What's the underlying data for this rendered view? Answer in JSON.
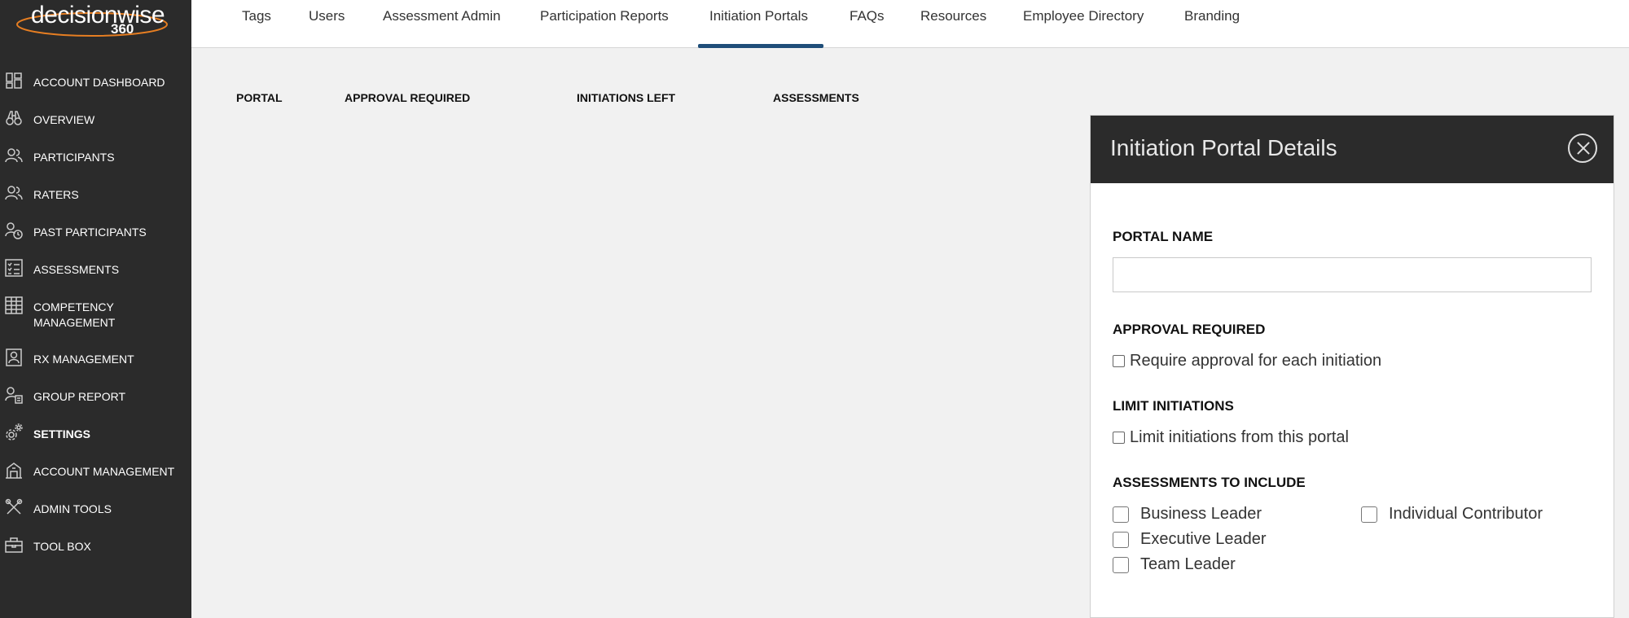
{
  "logo": {
    "name": "decisionwise",
    "suffix": "360"
  },
  "sidebar": {
    "items": [
      {
        "label": "ACCOUNT DASHBOARD",
        "icon": "dashboard-icon"
      },
      {
        "label": "OVERVIEW",
        "icon": "binoculars-icon"
      },
      {
        "label": "PARTICIPANTS",
        "icon": "users-icon"
      },
      {
        "label": "RATERS",
        "icon": "users-icon"
      },
      {
        "label": "PAST PARTICIPANTS",
        "icon": "users-history-icon"
      },
      {
        "label": "ASSESSMENTS",
        "icon": "checklist-icon"
      },
      {
        "label": "COMPETENCY MANAGEMENT",
        "icon": "grid-icon"
      },
      {
        "label": "RX MANAGEMENT",
        "icon": "user-clipboard-icon"
      },
      {
        "label": "GROUP REPORT",
        "icon": "group-report-icon"
      },
      {
        "label": "SETTINGS",
        "icon": "gear-icon"
      },
      {
        "label": "ACCOUNT MANAGEMENT",
        "icon": "building-icon"
      },
      {
        "label": "ADMIN TOOLS",
        "icon": "tools-icon"
      },
      {
        "label": "TOOL BOX",
        "icon": "toolbox-icon"
      }
    ],
    "active": "SETTINGS"
  },
  "tabs": [
    "Tags",
    "Users",
    "Assessment Admin",
    "Participation Reports",
    "Initiation Portals",
    "FAQs",
    "Resources",
    "Employee Directory",
    "Branding"
  ],
  "active_tab": "Initiation Portals",
  "table": {
    "headers": [
      "PORTAL",
      "APPROVAL REQUIRED",
      "INITIATIONS LEFT",
      "ASSESSMENTS"
    ]
  },
  "panel": {
    "title": "Initiation Portal Details",
    "portal_name_label": "PORTAL NAME",
    "portal_name_value": "",
    "approval_label": "APPROVAL REQUIRED",
    "approval_checkbox": "Require approval for each initiation",
    "limit_label": "LIMIT INITIATIONS",
    "limit_checkbox": "Limit initiations from this portal",
    "assessments_label": "ASSESSMENTS TO INCLUDE",
    "assessments": [
      "Business Leader",
      "Executive Leader",
      "Team Leader",
      "Individual Contributor"
    ]
  },
  "colors": {
    "sidebar": "#2b2b2b",
    "accent": "#1f4e79",
    "logo_swoosh": "#e67e22"
  }
}
